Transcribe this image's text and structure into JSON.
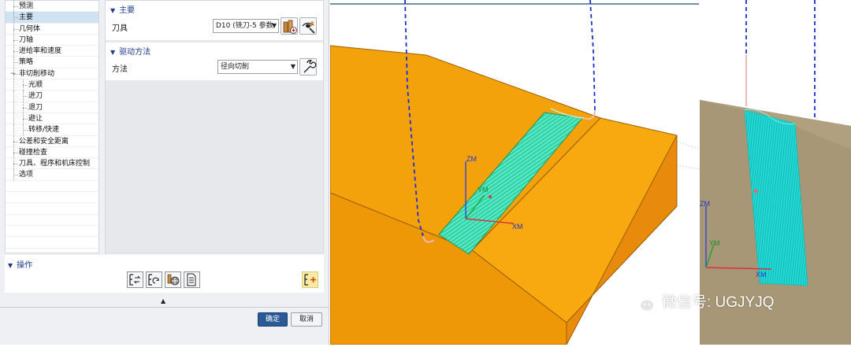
{
  "tree": {
    "items": [
      {
        "label": "预测",
        "depth": 1
      },
      {
        "label": "主要",
        "depth": 1,
        "selected": true
      },
      {
        "label": "几何体",
        "depth": 1
      },
      {
        "label": "刀轴",
        "depth": 1
      },
      {
        "label": "进给率和速度",
        "depth": 1
      },
      {
        "label": "策略",
        "depth": 1
      },
      {
        "label": "非切削移动",
        "depth": 1,
        "expanded": true
      },
      {
        "label": "光顺",
        "depth": 2
      },
      {
        "label": "进刀",
        "depth": 2
      },
      {
        "label": "退刀",
        "depth": 2
      },
      {
        "label": "避让",
        "depth": 2
      },
      {
        "label": "转移/快速",
        "depth": 2
      },
      {
        "label": "公差和安全距离",
        "depth": 1
      },
      {
        "label": "碰撞检查",
        "depth": 1
      },
      {
        "label": "刀具、程序和机床控制",
        "depth": 1
      },
      {
        "label": "选项",
        "depth": 1
      }
    ]
  },
  "main_group": {
    "title": "主要",
    "tool_label": "刀具",
    "tool_value": "D10 (铣刀-5 参数"
  },
  "drive_group": {
    "title": "驱动方法",
    "method_label": "方法",
    "method_value": "径向切削"
  },
  "operations": {
    "title": "操作"
  },
  "footer": {
    "ok_label": "确定",
    "cancel_label": "取消"
  },
  "viewport": {
    "axis_labels": {
      "zm": "ZM",
      "ym": "YM",
      "xm": "XM",
      "zm2": "ZM",
      "ym2": "YM",
      "xm2": "XM"
    },
    "watermark": "微信号: UGJYJQ",
    "colors": {
      "part_top": "#f5a10a",
      "part_side": "#e8900f",
      "toolpath": "#2fd6b0",
      "toolpath_lines": "#7cf2c8",
      "tool_axis": "#1c2ed8",
      "right_view_bg": "#a89776",
      "right_view_path": "#27e0d4"
    }
  }
}
